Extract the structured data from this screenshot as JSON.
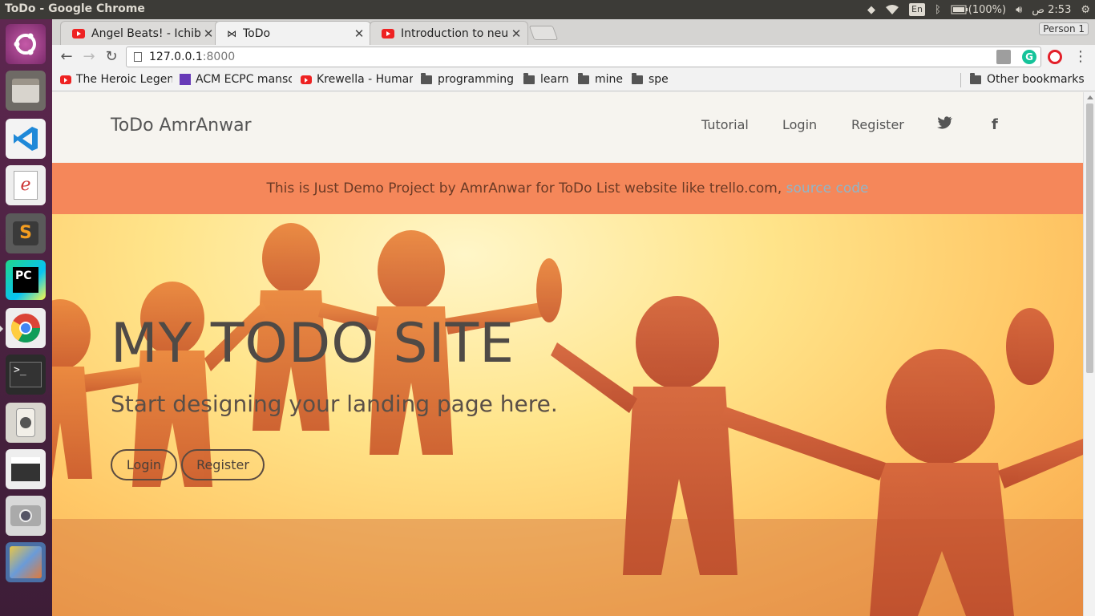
{
  "os": {
    "window_title": "ToDo - Google Chrome",
    "indicators": {
      "language": "En",
      "battery": "(100%)",
      "time": "2:53",
      "ampm": "ص"
    }
  },
  "launcher": {
    "items": [
      "ubuntu-dash",
      "files",
      "vscode",
      "document-viewer",
      "sublime-text",
      "pycharm",
      "chrome",
      "terminal",
      "speaker-app",
      "video-editor",
      "camera",
      "workspace-switcher"
    ]
  },
  "browser": {
    "tabs": [
      {
        "label": "Angel Beats! - Ichiba",
        "icon": "youtube-icon",
        "active": false
      },
      {
        "label": "ToDo",
        "icon": "bowtie-icon",
        "active": true
      },
      {
        "label": "Introduction to neu",
        "icon": "youtube-icon",
        "active": false
      }
    ],
    "person": "Person 1",
    "url_host": "127.0.0.1",
    "url_port": ":8000",
    "bookmarks": [
      {
        "label": "The Heroic Legen",
        "icon": "youtube-icon"
      },
      {
        "label": "ACM ECPC mansc",
        "icon": "list-icon"
      },
      {
        "label": "Krewella - Human",
        "icon": "youtube-icon"
      },
      {
        "label": "programming",
        "icon": "folder-icon"
      },
      {
        "label": "learn",
        "icon": "folder-icon"
      },
      {
        "label": "mine",
        "icon": "folder-icon"
      },
      {
        "label": "spe",
        "icon": "folder-icon"
      }
    ],
    "other_bookmarks": "Other bookmarks"
  },
  "site": {
    "brand": "ToDo AmrAnwar",
    "nav": {
      "tutorial": "Tutorial",
      "login": "Login",
      "register": "Register"
    },
    "banner_text": "This is Just Demo Project by AmrAnwar for ToDo List website like trello.com, ",
    "banner_link": "source code",
    "hero_title": "MY TODO SITE",
    "hero_subtitle": "Start designing your landing page here.",
    "hero_login": "Login",
    "hero_register": "Register"
  }
}
